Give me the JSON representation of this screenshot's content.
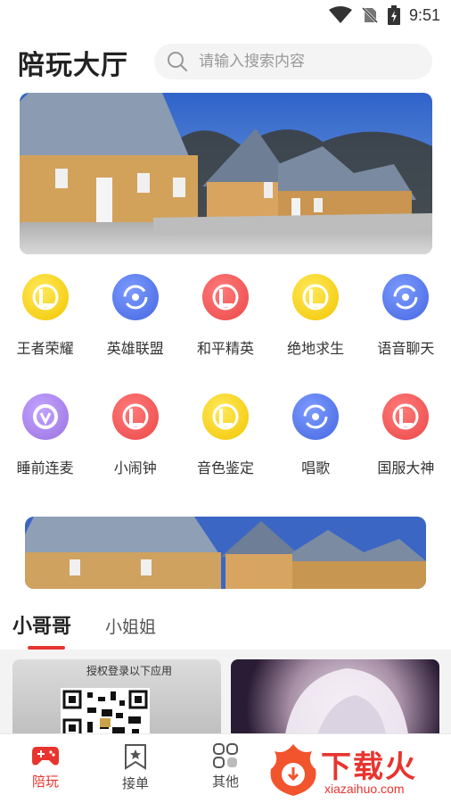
{
  "status_bar": {
    "time": "9:51",
    "icons": [
      "wifi-icon",
      "no-sim-icon",
      "battery-charging-icon"
    ]
  },
  "header": {
    "title": "陪玩大厅"
  },
  "search": {
    "placeholder": "请输入搜索内容"
  },
  "categories_row1": [
    {
      "label": "王者荣耀",
      "icon": "yellow-game-logo-icon"
    },
    {
      "label": "英雄联盟",
      "icon": "blue-target-icon"
    },
    {
      "label": "和平精英",
      "icon": "red-game-logo-icon"
    },
    {
      "label": "绝地求生",
      "icon": "yellow-game-logo-icon"
    },
    {
      "label": "语音聊天",
      "icon": "blue-target-icon"
    }
  ],
  "categories_row2": [
    {
      "label": "睡前连麦",
      "icon": "purple-overwatch-icon"
    },
    {
      "label": "小闹钟",
      "icon": "red-game-logo-icon"
    },
    {
      "label": "音色鉴定",
      "icon": "yellow-game-logo-icon"
    },
    {
      "label": "唱歌",
      "icon": "blue-target-icon"
    },
    {
      "label": "国服大神",
      "icon": "red-game-logo-icon"
    }
  ],
  "tabs": {
    "active": "小哥哥",
    "inactive": "小姐姐"
  },
  "cards": {
    "card1_text": "授权登录以下应用"
  },
  "bottom_nav": {
    "items": [
      {
        "label": "陪玩",
        "icon": "gamepad-icon",
        "active": true
      },
      {
        "label": "接单",
        "icon": "bookmark-star-icon",
        "active": false
      },
      {
        "label": "其他",
        "icon": "grid-apps-icon",
        "active": false
      }
    ]
  },
  "watermark": {
    "text": "下载火",
    "url_text": "xiazaihuo.com"
  },
  "colors": {
    "accent": "#e8342f",
    "yellow": "#f7d21c",
    "blue": "#5b7ff0",
    "red": "#f25a5a",
    "purple": "#a680e6"
  }
}
